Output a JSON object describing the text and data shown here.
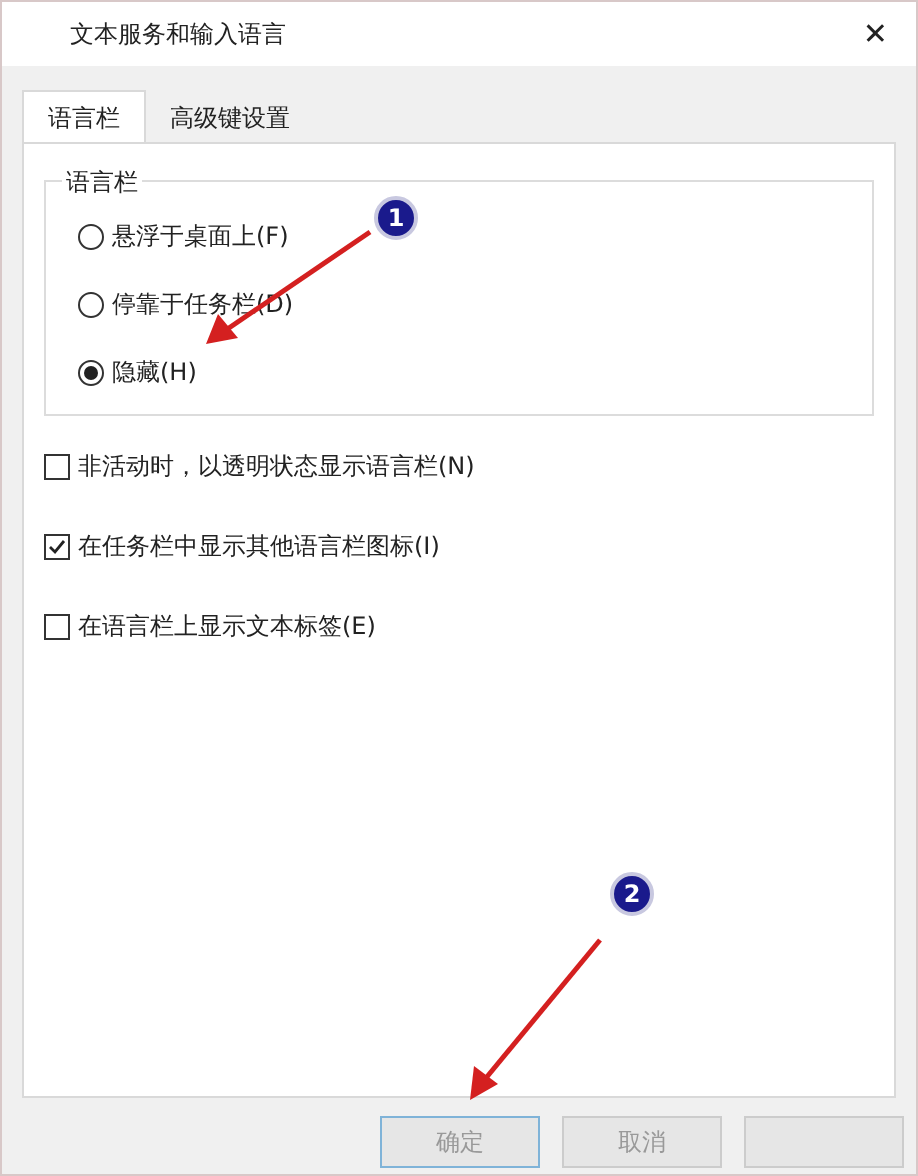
{
  "window": {
    "title": "文本服务和输入语言",
    "close": "✕"
  },
  "tabs": [
    {
      "label": "语言栏",
      "selected": true
    },
    {
      "label": "高级键设置",
      "selected": false
    }
  ],
  "language_bar_group": {
    "title": "语言栏",
    "options": [
      {
        "label": "悬浮于桌面上(F)",
        "selected": false
      },
      {
        "label": "停靠于任务栏(D)",
        "selected": false
      },
      {
        "label": "隐藏(H)",
        "selected": true
      }
    ]
  },
  "checkboxes": [
    {
      "label": "非活动时，以透明状态显示语言栏(N)",
      "checked": false
    },
    {
      "label": "在任务栏中显示其他语言栏图标(I)",
      "checked": true
    },
    {
      "label": "在语言栏上显示文本标签(E)",
      "checked": false
    }
  ],
  "annotations": [
    {
      "number": "1"
    },
    {
      "number": "2"
    }
  ],
  "buttons": [
    {
      "label": "确定",
      "default": true
    },
    {
      "label": "取消",
      "default": false
    },
    {
      "default": false
    }
  ]
}
